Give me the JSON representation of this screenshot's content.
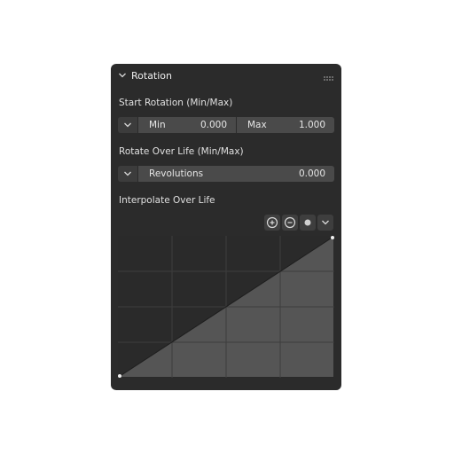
{
  "panel": {
    "title": "Rotation"
  },
  "start_rotation": {
    "label": "Start Rotation (Min/Max)",
    "min_label": "Min",
    "min_value": "0.000",
    "max_label": "Max",
    "max_value": "1.000"
  },
  "rotate_over_life": {
    "label": "Rotate Over Life (Min/Max)",
    "revolutions_label": "Revolutions",
    "revolutions_value": "0.000"
  },
  "interpolate": {
    "label": "Interpolate Over Life",
    "tools": [
      "zoom-in-icon",
      "zoom-out-icon",
      "handle-icon",
      "chevron-down-icon"
    ]
  },
  "curve": {
    "points": [
      [
        0,
        0
      ],
      [
        1,
        1
      ]
    ],
    "x_range": [
      0,
      1
    ],
    "y_range": [
      0,
      1
    ],
    "grid_divisions": 4
  },
  "colors": {
    "panel_bg": "#2b2b2b",
    "field_bg": "#4a4a4a",
    "curve_fill": "#555555",
    "curve_bg": "#2a2a2a",
    "grid": "#3d3d3d",
    "text": "#e6e6e6"
  }
}
